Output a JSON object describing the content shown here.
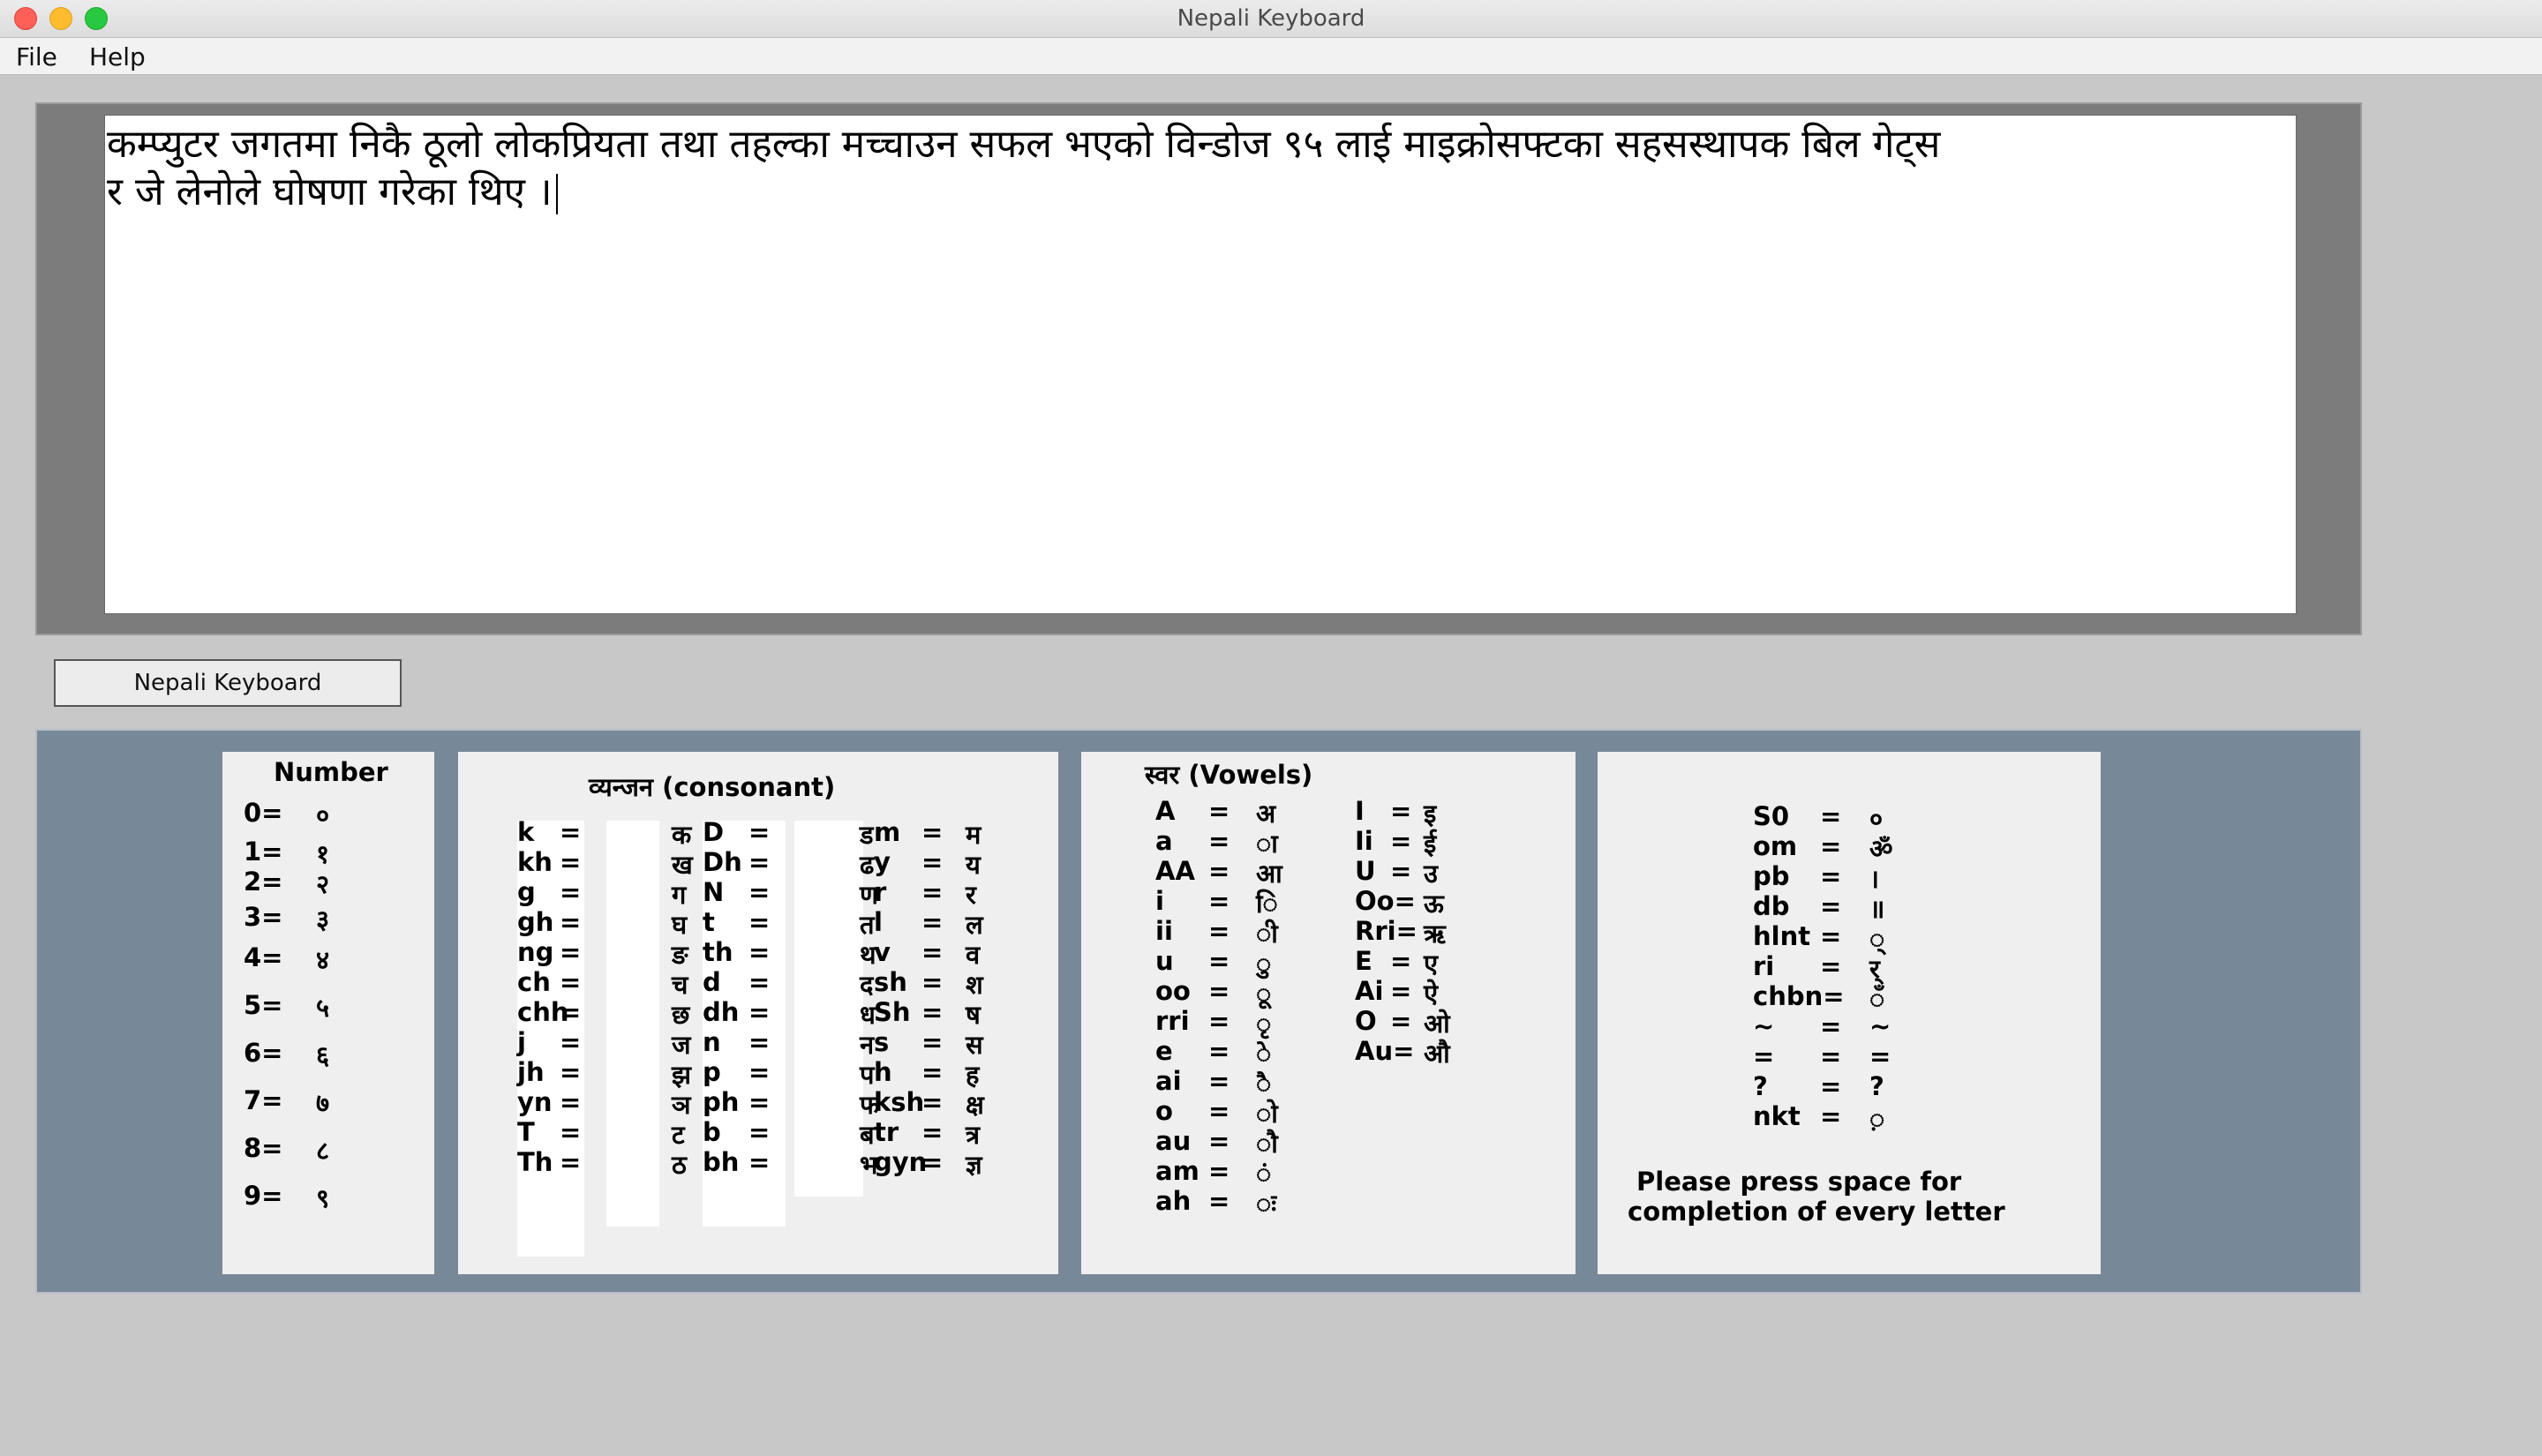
{
  "window": {
    "title": "Nepali Keyboard",
    "traffic_lights": {
      "close": "#fe5f57",
      "minimize": "#febc2e",
      "maximize": "#28c840"
    }
  },
  "menubar": {
    "file": "File",
    "help": "Help"
  },
  "editor": {
    "lines": [
      "कम्प्युटर जगतमा निकै ठूलो लोकप्रियता तथा तहल्का मच्चाउन सफल भएको विन्डोज ९५ लाई माइक्रोसफ्टका सहसस्थापक बिल गेट्स",
      "र जे लेनोले घोषणा गरेका थिए ।"
    ]
  },
  "keyboard_button": {
    "label": "Nepali Keyboard"
  },
  "colors": {
    "panel": "#778899",
    "card": "#efefef",
    "editor_frame": "#7c7c7c"
  },
  "number": {
    "title": "Number",
    "rows": [
      {
        "k": "0=",
        "v": "०"
      },
      {
        "k": "1=",
        "v": "१"
      },
      {
        "k": "2=",
        "v": "२"
      },
      {
        "k": "3=",
        "v": "३"
      },
      {
        "k": "4=",
        "v": "४"
      },
      {
        "k": "5=",
        "v": "५"
      },
      {
        "k": "6=",
        "v": "६"
      },
      {
        "k": "7=",
        "v": "७"
      },
      {
        "k": "8=",
        "v": "८"
      },
      {
        "k": "9=",
        "v": "९"
      }
    ]
  },
  "consonant": {
    "title": "व्यन्जन (consonant)",
    "col1": [
      {
        "k": "k",
        "e": "=",
        "v": "क"
      },
      {
        "k": "kh",
        "e": "=",
        "v": "ख"
      },
      {
        "k": "g",
        "e": "=",
        "v": "ग"
      },
      {
        "k": "gh",
        "e": "=",
        "v": "घ"
      },
      {
        "k": "ng",
        "e": "=",
        "v": "ङ"
      },
      {
        "k": "ch",
        "e": "=",
        "v": "च"
      },
      {
        "k": "chh",
        "e": "=",
        "v": "छ"
      },
      {
        "k": "j",
        "e": "=",
        "v": "ज"
      },
      {
        "k": "jh",
        "e": "=",
        "v": "झ"
      },
      {
        "k": "yn",
        "e": "=",
        "v": "ञ"
      },
      {
        "k": "T",
        "e": "=",
        "v": "ट"
      },
      {
        "k": "Th",
        "e": "=",
        "v": "ठ"
      }
    ],
    "col2": [
      {
        "k": "D",
        "e": "=",
        "v": "ड"
      },
      {
        "k": "Dh",
        "e": "=",
        "v": "ढ"
      },
      {
        "k": "N",
        "e": "=",
        "v": "ण"
      },
      {
        "k": "t",
        "e": "=",
        "v": "त"
      },
      {
        "k": "th",
        "e": "=",
        "v": "थ"
      },
      {
        "k": "d",
        "e": "=",
        "v": "द"
      },
      {
        "k": "dh",
        "e": "=",
        "v": "ध"
      },
      {
        "k": "n",
        "e": "=",
        "v": "न"
      },
      {
        "k": "p",
        "e": "=",
        "v": "प"
      },
      {
        "k": "ph",
        "e": "=",
        "v": "फ"
      },
      {
        "k": "b",
        "e": "=",
        "v": "ब"
      },
      {
        "k": "bh",
        "e": "=",
        "v": "भ"
      }
    ],
    "col3": [
      {
        "k": "m",
        "e": "=",
        "v": "म"
      },
      {
        "k": "y",
        "e": "=",
        "v": "य"
      },
      {
        "k": "r",
        "e": "=",
        "v": "र"
      },
      {
        "k": "l",
        "e": "=",
        "v": "ल"
      },
      {
        "k": "v",
        "e": "=",
        "v": "व"
      },
      {
        "k": "sh",
        "e": "=",
        "v": "श"
      },
      {
        "k": "Sh",
        "e": "=",
        "v": "ष"
      },
      {
        "k": "s",
        "e": "=",
        "v": "स"
      },
      {
        "k": "h",
        "e": "=",
        "v": "ह"
      },
      {
        "k": "ksh",
        "e": "=",
        "v": "क्ष"
      },
      {
        "k": "tr",
        "e": "=",
        "v": "त्र"
      },
      {
        "k": "gyn",
        "e": "=",
        "v": "ज्ञ"
      }
    ]
  },
  "vowels": {
    "title": "स्वर (Vowels)",
    "col1": [
      {
        "k": "A",
        "e": "=",
        "v": "अ"
      },
      {
        "k": "a",
        "e": "=",
        "v": "ा"
      },
      {
        "k": "AA",
        "e": "=",
        "v": "आ"
      },
      {
        "k": "i",
        "e": "=",
        "v": "ि"
      },
      {
        "k": "ii",
        "e": "=",
        "v": "ी"
      },
      {
        "k": "u",
        "e": "=",
        "v": "ु"
      },
      {
        "k": "oo",
        "e": "=",
        "v": "ू"
      },
      {
        "k": "rri",
        "e": "=",
        "v": "ृ"
      },
      {
        "k": "e",
        "e": "=",
        "v": "े"
      },
      {
        "k": "ai",
        "e": "=",
        "v": "ै"
      },
      {
        "k": "o",
        "e": "=",
        "v": "ो"
      },
      {
        "k": "au",
        "e": "=",
        "v": "ौ"
      },
      {
        "k": "am",
        "e": "=",
        "v": "ं"
      },
      {
        "k": "ah",
        "e": "=",
        "v": "ः"
      }
    ],
    "col2": [
      {
        "k": "I",
        "e": "=",
        "v": "इ"
      },
      {
        "k": "Ii",
        "e": "=",
        "v": "ई"
      },
      {
        "k": "U",
        "e": "=",
        "v": "उ"
      },
      {
        "k": "Oo=",
        "e": "",
        "v": "ऊ"
      },
      {
        "k": "Rri=",
        "e": "",
        "v": "ऋ"
      },
      {
        "k": "E",
        "e": "=",
        "v": "ए"
      },
      {
        "k": "Ai",
        "e": "=",
        "v": "ऐ"
      },
      {
        "k": "O",
        "e": "=",
        "v": "ओ"
      },
      {
        "k": "Au=",
        "e": "",
        "v": "औ"
      }
    ]
  },
  "misc": {
    "rows": [
      {
        "k": "S0",
        "e": "=",
        "v": "०"
      },
      {
        "k": "om",
        "e": "=",
        "v": "ॐ"
      },
      {
        "k": "pb",
        "e": "=",
        "v": "।"
      },
      {
        "k": "db",
        "e": "=",
        "v": "॥"
      },
      {
        "k": "hlnt",
        "e": "=",
        "v": "्"
      },
      {
        "k": "ri",
        "e": "=",
        "v": "र्"
      },
      {
        "k": "chbn=",
        "e": "",
        "v": "ँ"
      },
      {
        "k": "~",
        "e": "=",
        "v": "~"
      },
      {
        "k": "=",
        "e": "=",
        "v": "="
      },
      {
        "k": "?",
        "e": "=",
        "v": "?"
      },
      {
        "k": "nkt",
        "e": "=",
        "v": "़"
      }
    ],
    "note_line1": "Please press space for",
    "note_line2": "completion of every letter"
  }
}
